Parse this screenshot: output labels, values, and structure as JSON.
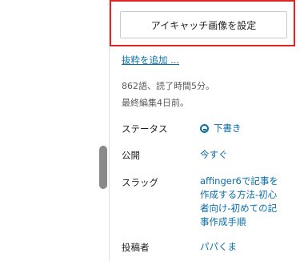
{
  "sidebar": {
    "featured_image_button": "アイキャッチ画像を設定",
    "excerpt_link": "抜粋を追加 ...",
    "word_count": "862語、読了時間5分。",
    "last_edited": "最終編集4日前。",
    "rows": [
      {
        "label": "ステータス",
        "value": "下書き"
      },
      {
        "label": "公開",
        "value": "今すぐ"
      },
      {
        "label": "スラッグ",
        "value_lines": [
          "affinger6で記事を",
          "作成する方法-初心",
          "者向け-初めての記",
          "事作成手順"
        ]
      },
      {
        "label": "投稿者",
        "value": "パパくま"
      }
    ]
  },
  "colors": {
    "highlight": "#e02424",
    "link": "#0a6ea8"
  }
}
